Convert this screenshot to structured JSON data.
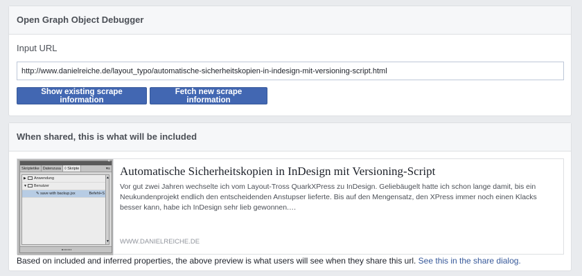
{
  "panel1": {
    "title": "Open Graph Object Debugger",
    "input_label": "Input URL",
    "url_value": "http://www.danielreiche.de/layout_typo/automatische-sicherheitskopien-in-indesign-mit-versioning-script.html",
    "btn_show": "Show existing scrape information",
    "btn_fetch": "Fetch new scrape information"
  },
  "panel2": {
    "title": "When shared, this is what will be included",
    "preview": {
      "title": "Automatische Sicherheitskopien in InDesign mit Versioning-Script",
      "description": "Vor gut zwei Jahren wechselte ich vom Layout-Tross QuarkXPress zu InDesign. Geliebäugelt hatte ich schon lange damit, bis ein Neukundenprojekt endlich den entscheidenden Anstupser lieferte. Bis auf den Mengensatz, den XPress immer noch einen Klacks besser kann, habe ich InDesign sehr lieb gewonnen.…",
      "domain": "WWW.DANIELREICHE.DE",
      "thumb": {
        "collapse": "«",
        "tabs": [
          "Skriptetike",
          "Datenzusa",
          "◊ Skripte"
        ],
        "menu": "▾≡",
        "rows": [
          {
            "label": "Anwendung"
          },
          {
            "label": "Benutzer"
          },
          {
            "label": "save with backup.jsx",
            "shortcut": "Befehl+S"
          }
        ]
      }
    },
    "footer_text": "Based on included and inferred properties, the above preview is what users will see when they share this url.",
    "footer_link": "See this in the share dialog."
  },
  "colors": {
    "primary_button": "#4267b2",
    "link": "#365899",
    "page_bg": "#e9ebee"
  }
}
